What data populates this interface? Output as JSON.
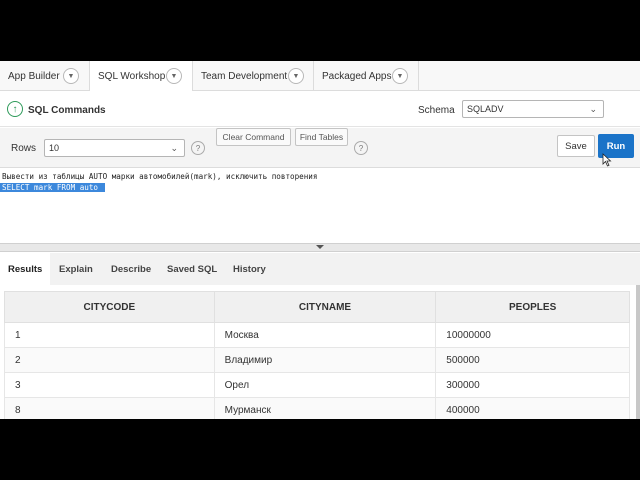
{
  "tabs": [
    {
      "label": "App Builder"
    },
    {
      "label": "SQL Workshop"
    },
    {
      "label": "Team Development"
    },
    {
      "label": "Packaged Apps"
    }
  ],
  "header": {
    "title": "SQL Commands",
    "schema_label": "Schema",
    "schema_value": "SQLADV"
  },
  "toolbar": {
    "rows_label": "Rows",
    "rows_value": "10",
    "clear_label": "Clear Command",
    "find_label": "Find Tables",
    "save_label": "Save",
    "run_label": "Run"
  },
  "editor": {
    "line1": "Вывести из таблицы AUTO марки автомобилей(mark), исключить повторения",
    "line2": "SELECT mark FROM auto "
  },
  "result_tabs": [
    {
      "label": "Results"
    },
    {
      "label": "Explain"
    },
    {
      "label": "Describe"
    },
    {
      "label": "Saved SQL"
    },
    {
      "label": "History"
    }
  ],
  "table": {
    "columns": [
      "CITYCODE",
      "CITYNAME",
      "PEOPLES"
    ],
    "rows": [
      [
        "1",
        "Москва",
        "10000000"
      ],
      [
        "2",
        "Владимир",
        "500000"
      ],
      [
        "3",
        "Орел",
        "300000"
      ],
      [
        "8",
        "Мурманск",
        "400000"
      ]
    ]
  }
}
